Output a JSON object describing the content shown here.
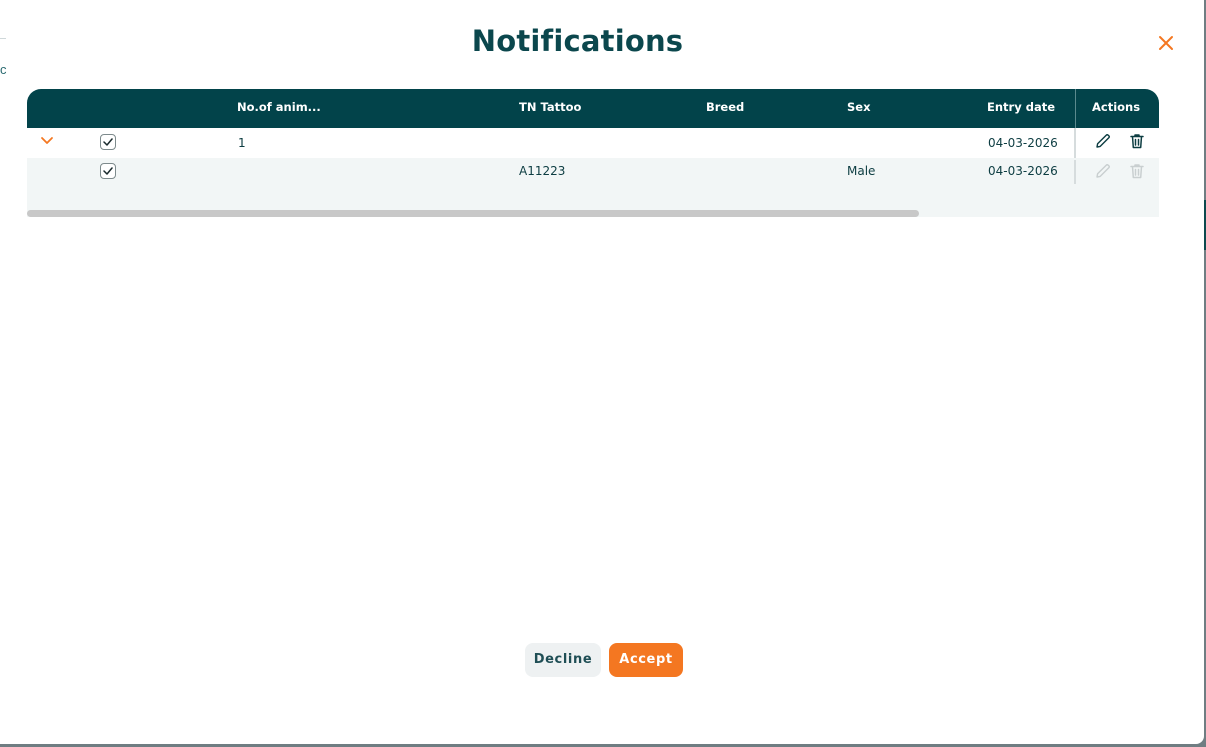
{
  "modal": {
    "title": "Notifications",
    "side_glimpse_char": "c"
  },
  "table": {
    "columns": {
      "no_of_animals": "No.of anim...",
      "tn_tattoo": "TN Tattoo",
      "breed": "Breed",
      "sex": "Sex",
      "entry_date": "Entry date",
      "actions": "Actions"
    },
    "rows": [
      {
        "expanded": true,
        "checked": true,
        "no_of_animals": "1",
        "tn_tattoo": "",
        "breed": "",
        "sex": "",
        "entry_date": "04-03-2026",
        "actions_enabled": true
      },
      {
        "checked": true,
        "no_of_animals": "",
        "tn_tattoo": "A11223",
        "breed": "",
        "sex": "Male",
        "entry_date": "04-03-2026",
        "actions_enabled": false
      }
    ]
  },
  "footer": {
    "decline_label": "Decline",
    "accept_label": "Accept"
  },
  "colors": {
    "header_bg": "#02434a",
    "accent_orange": "#f47721",
    "title_color": "#0b474d"
  },
  "icons": {
    "close": "close-icon",
    "expand": "chevron-down-icon",
    "check": "checkmark-icon",
    "edit": "pencil-icon",
    "delete": "trash-icon"
  }
}
